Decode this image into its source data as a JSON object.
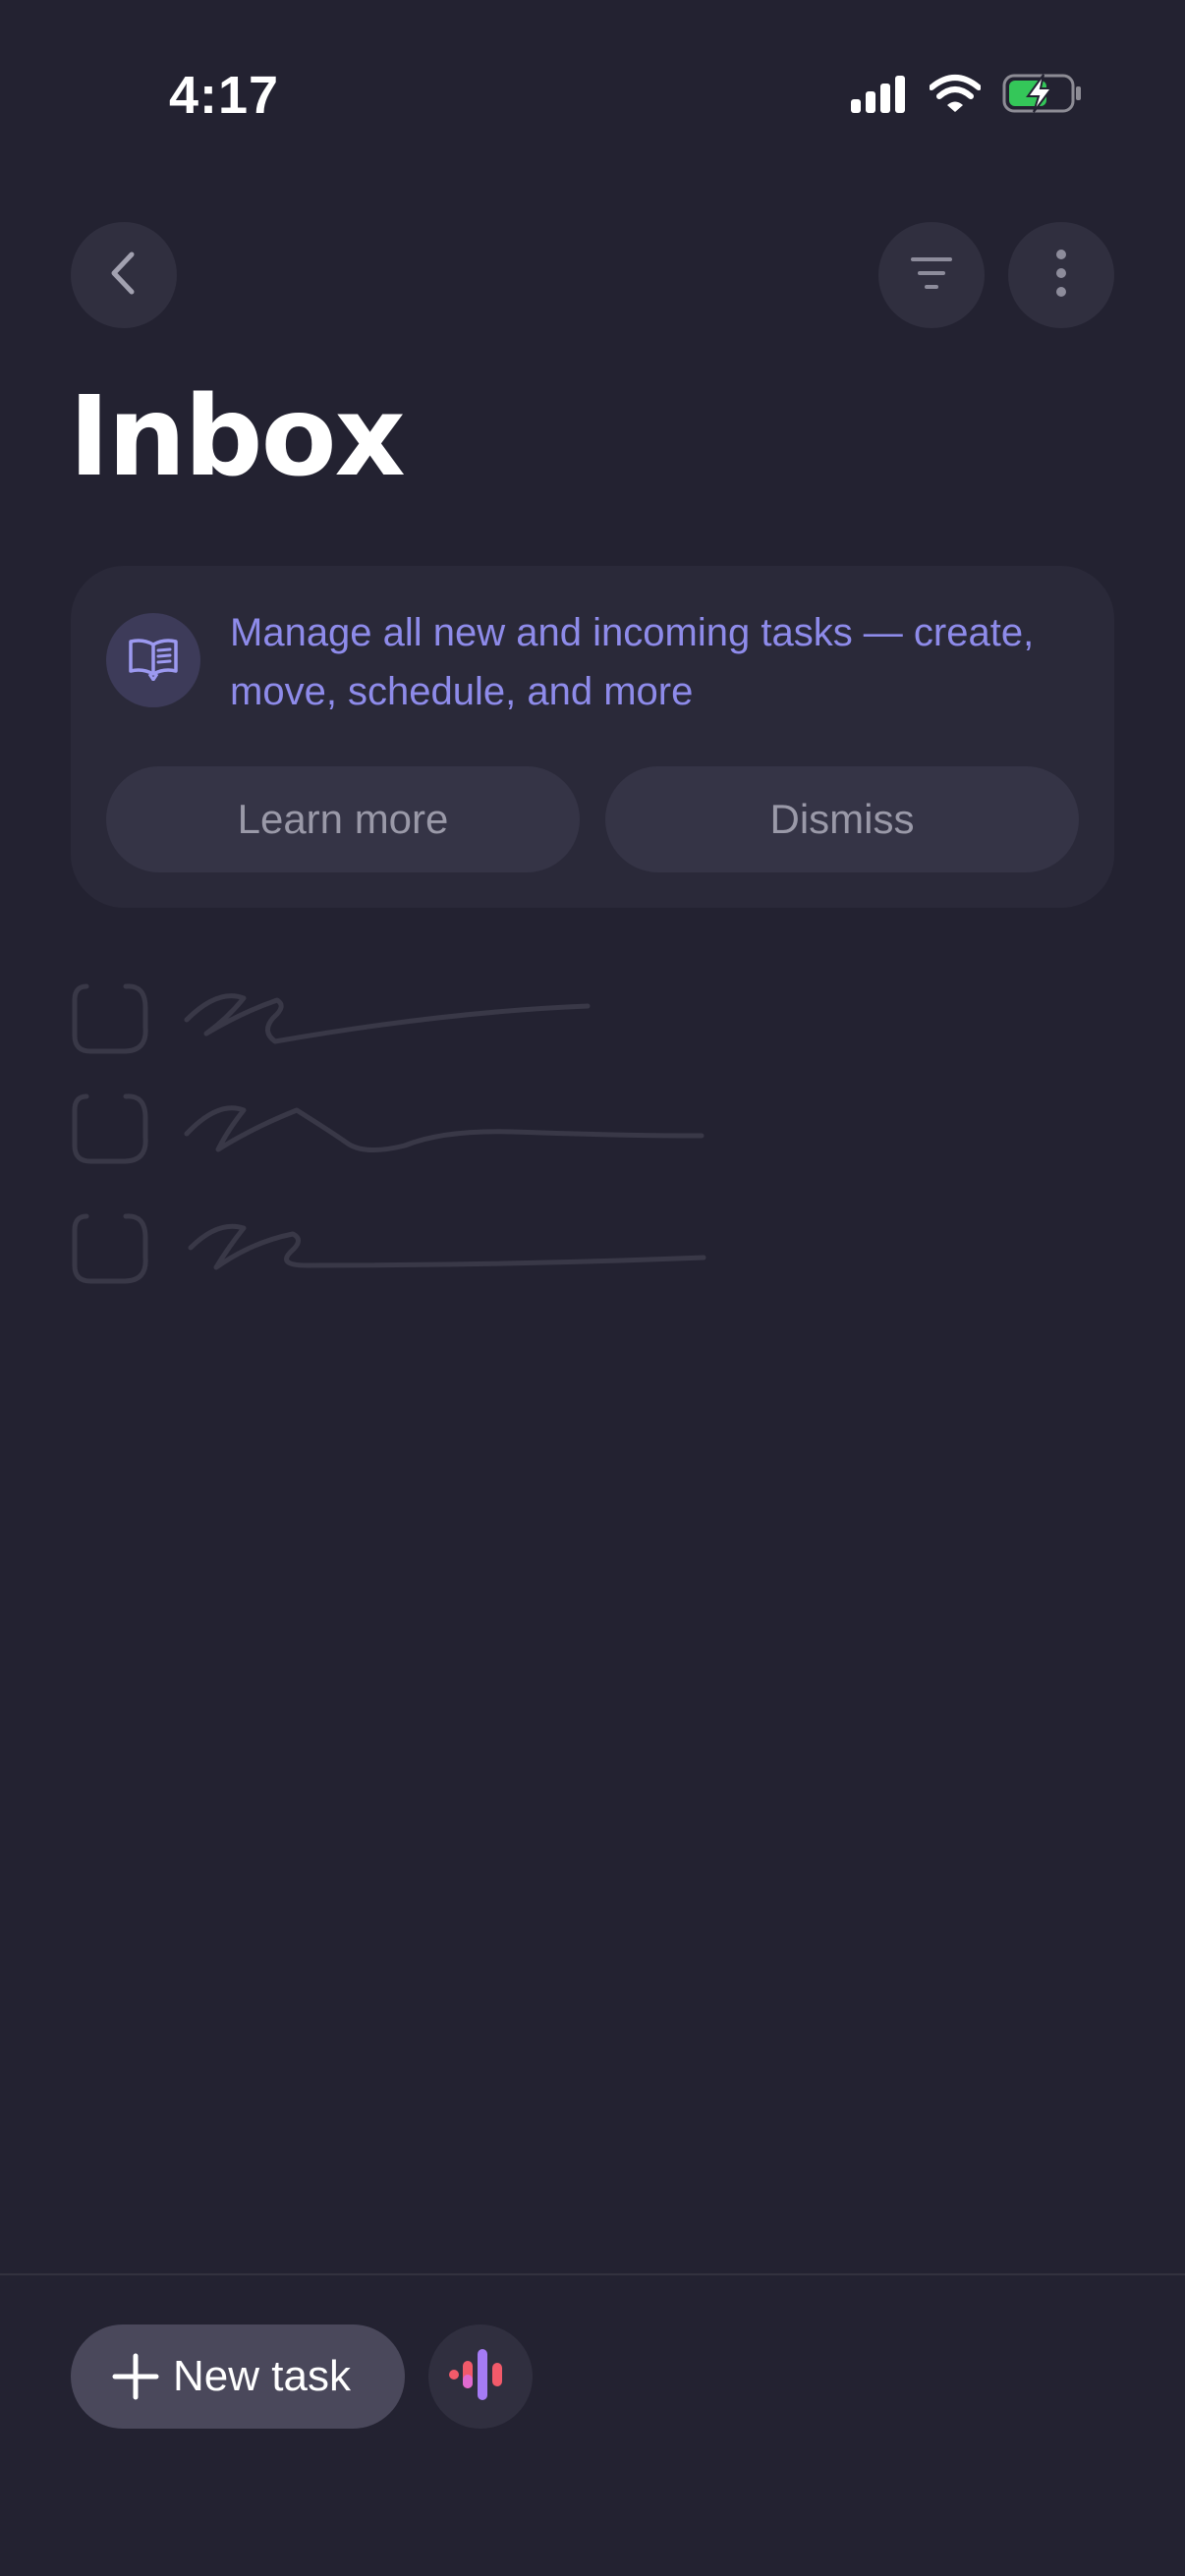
{
  "status_bar": {
    "time": "4:17",
    "icons": [
      "cellular-signal-icon",
      "wifi-icon",
      "battery-charging-icon"
    ],
    "battery_color": "#34c759"
  },
  "header": {
    "back_icon": "chevron-left-icon",
    "filter_icon": "filter-lines-icon",
    "more_icon": "vertical-ellipsis-icon"
  },
  "page": {
    "title": "Inbox"
  },
  "info_card": {
    "icon": "open-book-icon",
    "message": "Manage all new and incoming tasks — create, move, schedule, and more",
    "learn_more_label": "Learn more",
    "dismiss_label": "Dismiss"
  },
  "empty_state": {
    "placeholder_rows": 3
  },
  "bottom_bar": {
    "new_task_label": "New task",
    "new_task_icon": "plus-icon",
    "voice_icon": "voice-waveform-icon"
  },
  "colors": {
    "background": "#232231",
    "accent": "#8e8bea",
    "card": "#2a2939",
    "button": "#353446"
  }
}
